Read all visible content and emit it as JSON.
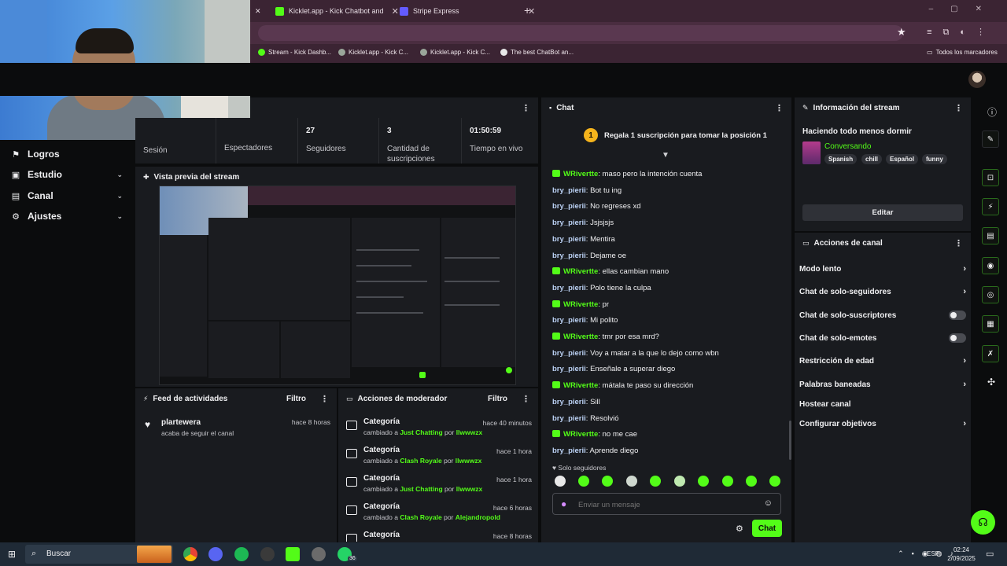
{
  "browser": {
    "tabs": [
      {
        "label": "Kicklet.app - Kick Chatbot and",
        "color": "#53fc18"
      },
      {
        "label": "Stripe Express",
        "color": "#635bff"
      }
    ],
    "bookmarks": [
      "Stream - Kick Dashb...",
      "Kicklet.app - Kick C...",
      "Kicklet.app - Kick C...",
      "The best ChatBot an..."
    ],
    "bookmarks_folder": "Todos los marcadores"
  },
  "sidebar": {
    "items": [
      {
        "label": "Logros",
        "icon": "trophy-icon",
        "glyph": "⚑"
      },
      {
        "label": "Estudio",
        "icon": "studio-icon",
        "glyph": "▣",
        "chevron": "⌄"
      },
      {
        "label": "Canal",
        "icon": "channel-icon",
        "glyph": "▤",
        "chevron": "⌄"
      },
      {
        "label": "Ajustes",
        "icon": "gear-icon",
        "glyph": "⚙",
        "chevron": "⌄"
      }
    ]
  },
  "stats": {
    "session_label": "Sesión",
    "viewers_label": "Espectadores",
    "followers": {
      "value": "27",
      "label": "Seguidores"
    },
    "subs": {
      "value": "3",
      "label": "Cantidad de suscripciones"
    },
    "live": {
      "value": "01:50:59",
      "label": "Tiempo en vivo"
    }
  },
  "preview": {
    "title": "Vista previa del stream"
  },
  "feed": {
    "title": "Feed de actividades",
    "filter": "Filtro",
    "items": [
      {
        "user": "plartewera",
        "text": "acaba de seguir el canal",
        "time": "hace 8 horas"
      }
    ]
  },
  "mod": {
    "title": "Acciones de moderador",
    "filter": "Filtro",
    "rows": [
      {
        "title": "Categoría",
        "pre": "cambiado a",
        "cat": "Just Chatting",
        "by": "por",
        "user": "llwwwzx",
        "time": "hace 40 minutos"
      },
      {
        "title": "Categoría",
        "pre": "cambiado a",
        "cat": "Clash Royale",
        "by": "por",
        "user": "llwwwzx",
        "time": "hace 1 hora"
      },
      {
        "title": "Categoría",
        "pre": "cambiado a",
        "cat": "Just Chatting",
        "by": "por",
        "user": "llwwwzx",
        "time": "hace 1 hora"
      },
      {
        "title": "Categoría",
        "pre": "cambiado a",
        "cat": "Clash Royale",
        "by": "por",
        "user": "Alejandropold",
        "time": "hace 6 horas"
      },
      {
        "title": "Categoría",
        "pre": "",
        "cat": "",
        "by": "",
        "user": "",
        "time": "hace 8 horas"
      }
    ]
  },
  "chat": {
    "title": "Chat",
    "goal_rank": "1",
    "goal": "Regala 1 suscripción para tomar la posición 1",
    "messages": [
      {
        "user": "WRivertte",
        "badge": true,
        "text": "maso pero la intención cuenta"
      },
      {
        "user": "bry_pierii",
        "badge": false,
        "text": "Bot tu ing"
      },
      {
        "user": "bry_pierii",
        "badge": false,
        "text": "No regreses xd"
      },
      {
        "user": "bry_pierii",
        "badge": false,
        "text": "Jsjsjsjs"
      },
      {
        "user": "bry_pierii",
        "badge": false,
        "text": "Mentira"
      },
      {
        "user": "bry_pierii",
        "badge": false,
        "text": "Dejame oe"
      },
      {
        "user": "WRivertte",
        "badge": true,
        "text": "ellas cambian mano"
      },
      {
        "user": "bry_pierii",
        "badge": false,
        "text": "Polo tiene la culpa"
      },
      {
        "user": "WRivertte",
        "badge": true,
        "text": "pr"
      },
      {
        "user": "bry_pierii",
        "badge": false,
        "text": "Mi polito"
      },
      {
        "user": "WRivertte",
        "badge": true,
        "text": "tmr por esa mrd?"
      },
      {
        "user": "bry_pierii",
        "badge": false,
        "text": "Voy a matar a la que lo dejo como wbn"
      },
      {
        "user": "bry_pierii",
        "badge": false,
        "text": "Enseñale a superar diego"
      },
      {
        "user": "WRivertte",
        "badge": true,
        "text": "mátala te paso su dirección"
      },
      {
        "user": "bry_pierii",
        "badge": false,
        "text": "Sill"
      },
      {
        "user": "bry_pierii",
        "badge": false,
        "text": "Resolvió"
      },
      {
        "user": "WRivertte",
        "badge": true,
        "text": "no me cae"
      },
      {
        "user": "bry_pierii",
        "badge": false,
        "text": "Aprende diego"
      }
    ],
    "mode": "Solo seguidores",
    "placeholder": "Enviar un mensaje",
    "send": "Chat"
  },
  "info": {
    "title": "Información del stream",
    "stream_title": "Haciendo todo menos dormir",
    "category": "Conversando",
    "tags": [
      "Spanish",
      "chill",
      "Español",
      "funny"
    ],
    "edit": "Editar"
  },
  "actions": {
    "title": "Acciones de canal",
    "items": [
      {
        "label": "Modo lento",
        "kind": "chevron"
      },
      {
        "label": "Chat de solo-seguidores",
        "kind": "chevron"
      },
      {
        "label": "Chat de solo-suscriptores",
        "kind": "toggle"
      },
      {
        "label": "Chat de solo-emotes",
        "kind": "toggle"
      },
      {
        "label": "Restricción de edad",
        "kind": "chevron"
      },
      {
        "label": "Palabras baneadas",
        "kind": "chevron"
      },
      {
        "label": "Hostear canal",
        "kind": "none"
      },
      {
        "label": "Configurar objetivos",
        "kind": "chevron"
      }
    ]
  },
  "taskbar": {
    "search": "Buscar",
    "badge": "36",
    "lang": "ESP",
    "time": "02:24",
    "date": "2/09/2025"
  }
}
